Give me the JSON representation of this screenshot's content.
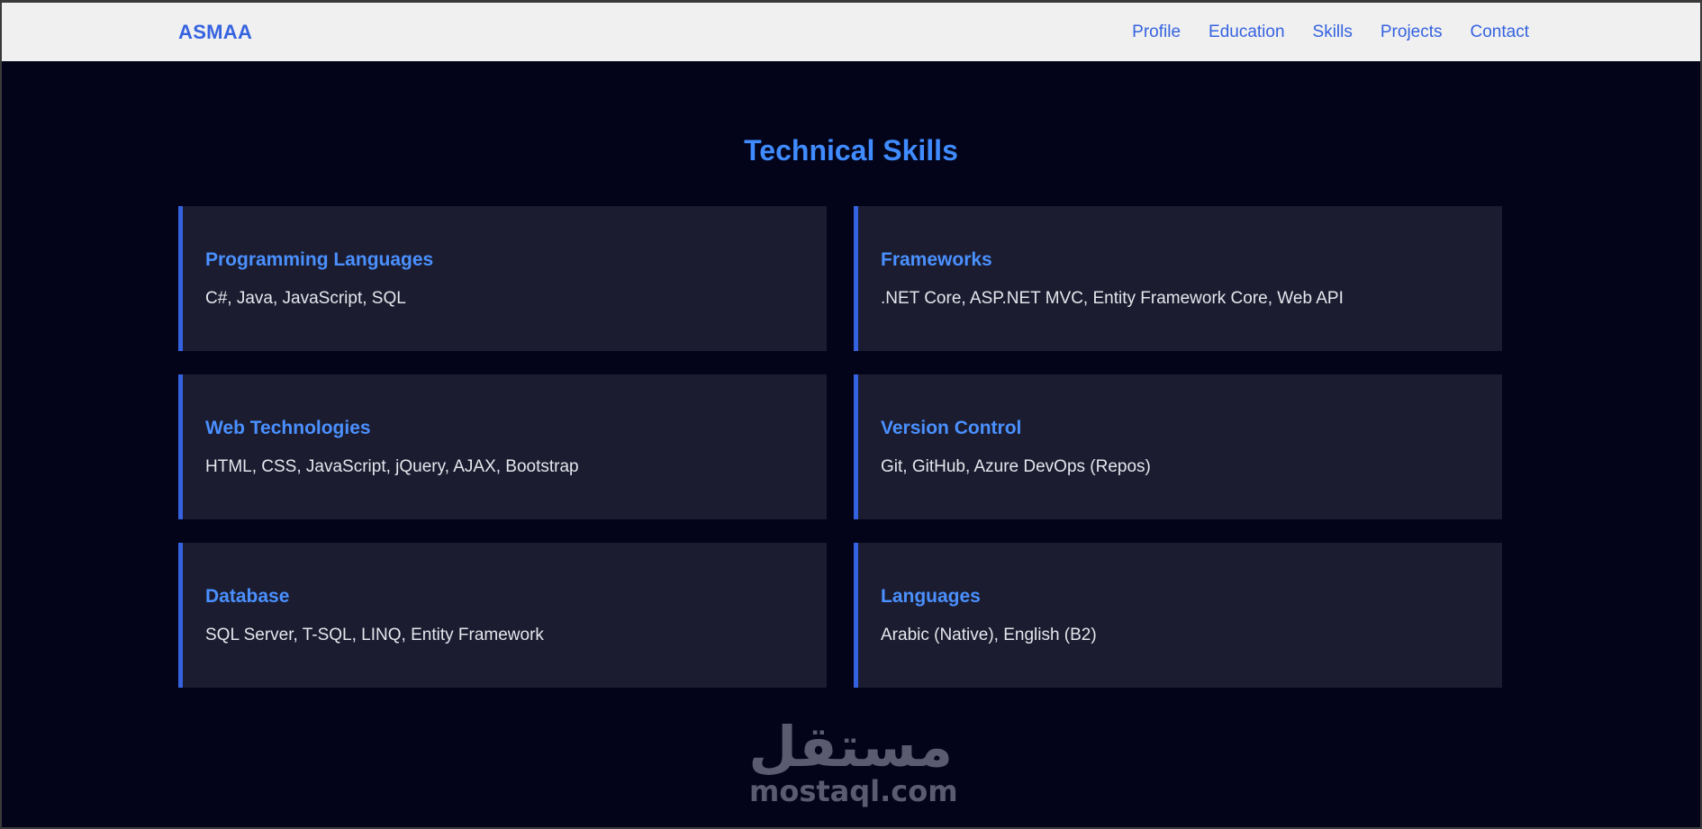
{
  "navbar": {
    "brand": "ASMAA",
    "links": [
      {
        "label": "Profile"
      },
      {
        "label": "Education"
      },
      {
        "label": "Skills"
      },
      {
        "label": "Projects"
      },
      {
        "label": "Contact"
      }
    ]
  },
  "skills": {
    "title": "Technical Skills",
    "cards": [
      {
        "title": "Programming Languages",
        "text": "C#, Java, JavaScript, SQL"
      },
      {
        "title": "Frameworks",
        "text": ".NET Core, ASP.NET MVC, Entity Framework Core, Web API"
      },
      {
        "title": "Web Technologies",
        "text": "HTML, CSS, JavaScript, jQuery, AJAX, Bootstrap"
      },
      {
        "title": "Version Control",
        "text": "Git, GitHub, Azure DevOps (Repos)"
      },
      {
        "title": "Database",
        "text": "SQL Server, T-SQL, LINQ, Entity Framework"
      },
      {
        "title": "Languages",
        "text": "Arabic (Native), English (B2)"
      }
    ]
  },
  "watermark": {
    "arabic": "مستقل",
    "latin": "mostaql.com"
  },
  "colors": {
    "accent": "#3563e0",
    "heading": "#3f8bff",
    "background": "#03041a",
    "card": "#1b1c2f",
    "navbar": "#f0f0f0"
  }
}
